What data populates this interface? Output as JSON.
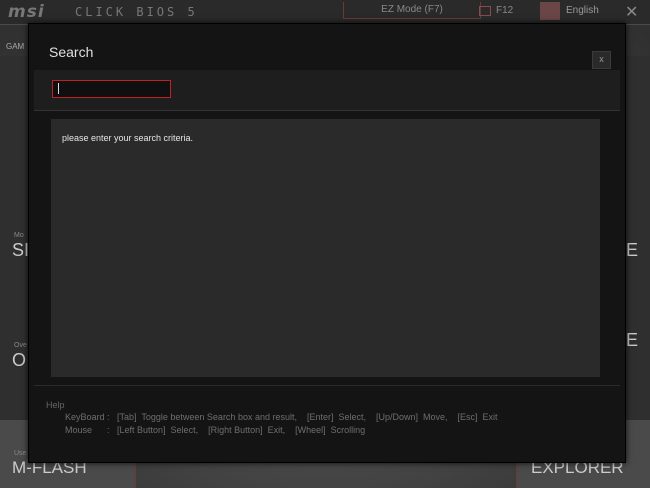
{
  "header": {
    "logo": "msi",
    "bios_name": "CLICK BIOS 5",
    "ez_mode": "EZ Mode (F7)",
    "f12": "F12",
    "language": "English",
    "close": "✕"
  },
  "background": {
    "top_left_label": "GAM",
    "tiles": {
      "settings_small": "Mo",
      "settings_big": "SI",
      "oc_small": "Ove",
      "oc_big": "O",
      "mflash_small": "Use",
      "mflash": "M-FLASH",
      "explorer": "EXPLORER",
      "right_big_1": "E",
      "right_big_2": "E"
    }
  },
  "dialog": {
    "title": "Search",
    "close_label": "x",
    "search": {
      "value": "",
      "placeholder": ""
    },
    "results_message": "please enter your search criteria.",
    "help": {
      "title": "Help",
      "keyboard": "KeyBoard :   [Tab]  Toggle between Search box and result,    [Enter]  Select,    [Up/Down]  Move,    [Esc]  Exit",
      "mouse": "Mouse      :   [Left Button]  Select,    [Right Button]  Exit,    [Wheel]  Scrolling"
    }
  }
}
